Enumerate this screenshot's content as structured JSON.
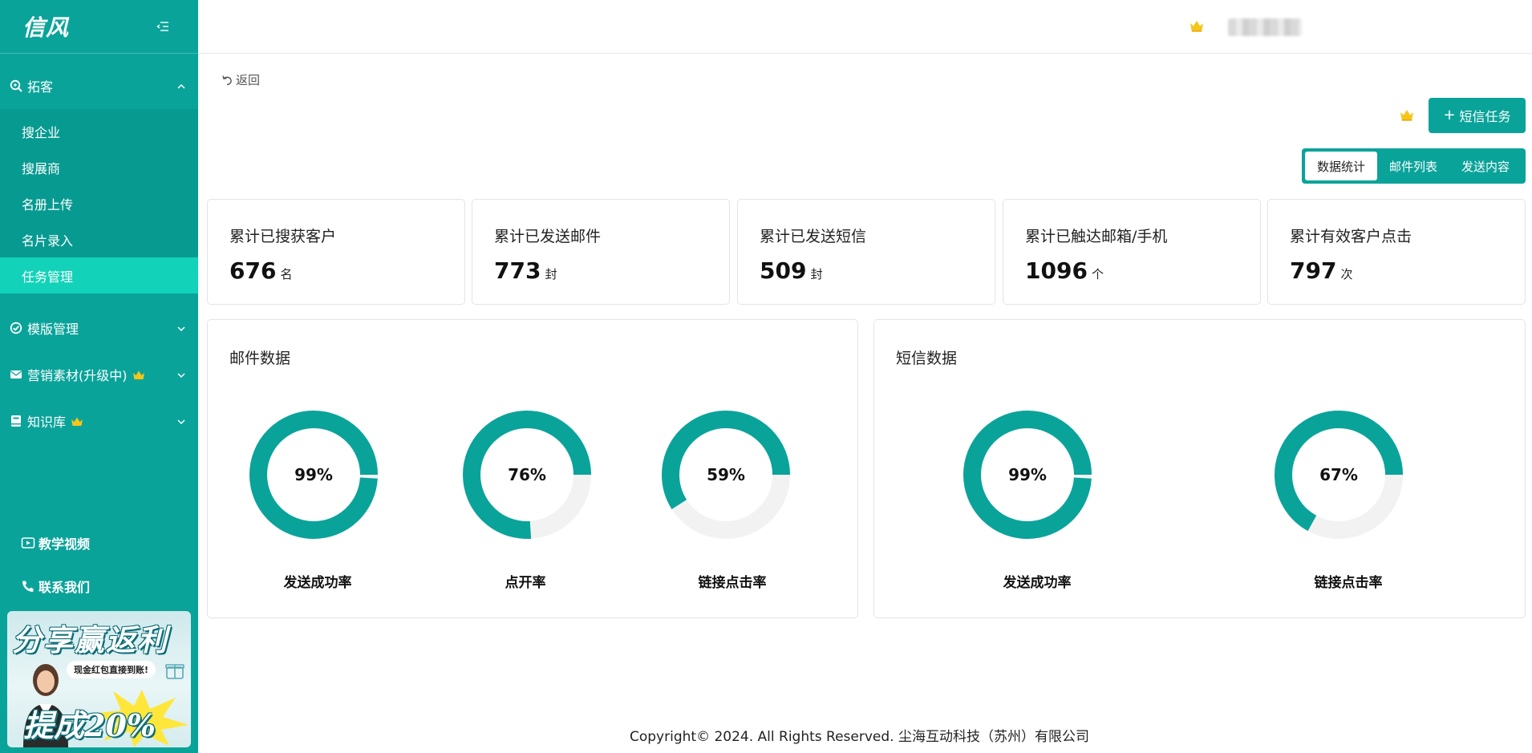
{
  "sidebar": {
    "logo": "信风",
    "groups": [
      {
        "label": "拓客",
        "expanded": true,
        "items": [
          "搜企业",
          "搜展商",
          "名册上传",
          "名片录入",
          "任务管理"
        ],
        "active_item": "任务管理"
      },
      {
        "label": "模版管理",
        "expanded": false
      },
      {
        "label": "营销素材(升级中)",
        "expanded": false,
        "crown": true
      },
      {
        "label": "知识库",
        "expanded": false,
        "crown": true
      }
    ],
    "bottom_links": {
      "video": "教学视频",
      "contact": "联系我们"
    },
    "promo": {
      "title": "分享赢返利",
      "pill": "现金红包直接到账!",
      "bottom": "提成20%"
    }
  },
  "header": {},
  "main": {
    "back_label": "返回",
    "sms_task_button": "短信任务",
    "tabs": [
      "数据统计",
      "邮件列表",
      "发送内容"
    ],
    "active_tab": "数据统计",
    "stats": [
      {
        "label": "累计已搜获客户",
        "value": "676",
        "unit": "名"
      },
      {
        "label": "累计已发送邮件",
        "value": "773",
        "unit": "封"
      },
      {
        "label": "累计已发送短信",
        "value": "509",
        "unit": "封"
      },
      {
        "label": "累计已触达邮箱/手机",
        "value": "1096",
        "unit": "个"
      },
      {
        "label": "累计有效客户点击",
        "value": "797",
        "unit": "次"
      }
    ],
    "email_panel": {
      "title": "邮件数据",
      "gauges": [
        {
          "label": "发送成功率",
          "percent": 99,
          "text": "99%"
        },
        {
          "label": "点开率",
          "percent": 76,
          "text": "76%"
        },
        {
          "label": "链接点击率",
          "percent": 59,
          "text": "59%"
        }
      ]
    },
    "sms_panel": {
      "title": "短信数据",
      "gauges": [
        {
          "label": "发送成功率",
          "percent": 99,
          "text": "99%"
        },
        {
          "label": "链接点击率",
          "percent": 67,
          "text": "67%"
        }
      ]
    },
    "accent_color": "#0aa39a"
  },
  "footer": {
    "text": "Copyright© 2024. All Rights Reserved. 尘海互动科技（苏州）有限公司"
  }
}
